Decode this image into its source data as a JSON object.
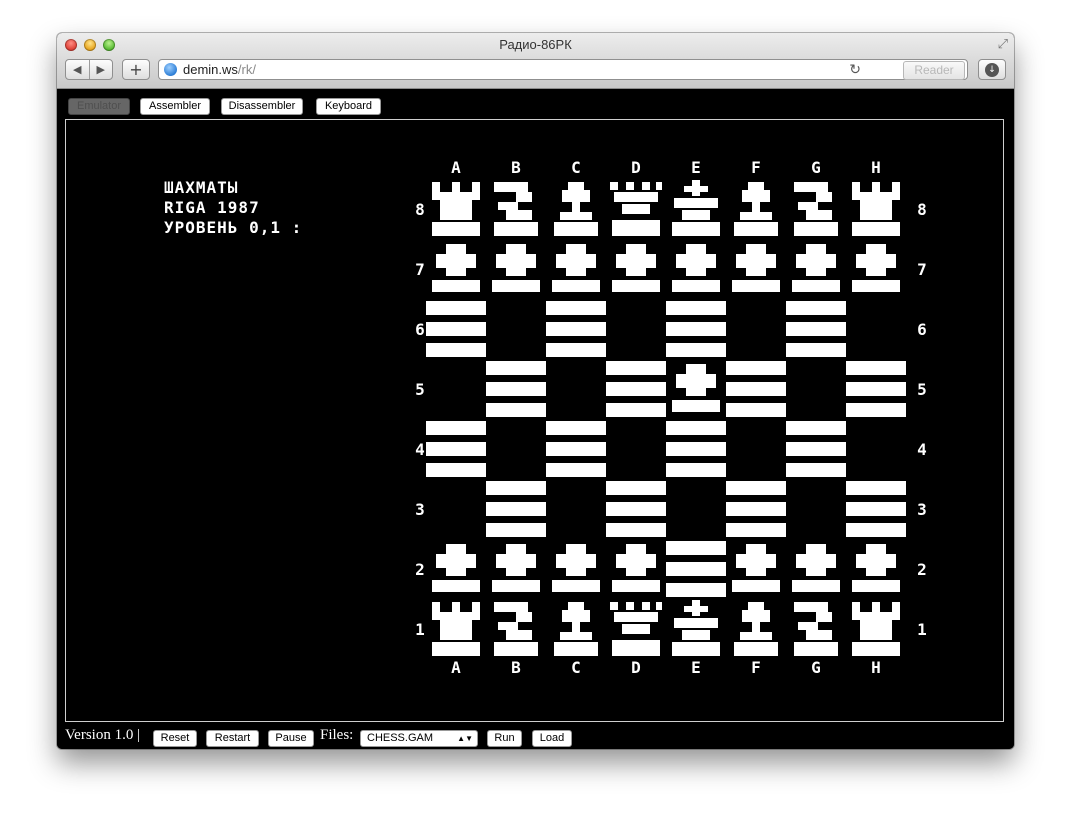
{
  "window": {
    "title": "Радио-86РК"
  },
  "url": {
    "host": "demin.ws",
    "path": "/rk/"
  },
  "reader_label": "Reader",
  "topbar": {
    "emulator": "Emulator",
    "assembler": "Assembler",
    "disassembler": "Disassembler",
    "keyboard": "Keyboard"
  },
  "screen": {
    "line1": "ШАХМАТЫ",
    "line2": "RIGA 1987",
    "line3": "УРОВЕНЬ 0,1 :",
    "files": [
      "A",
      "B",
      "C",
      "D",
      "E",
      "F",
      "G",
      "H"
    ],
    "ranks": [
      "8",
      "7",
      "6",
      "5",
      "4",
      "3",
      "2",
      "1"
    ]
  },
  "board": {
    "rank8": [
      "rook",
      "knight",
      "bishop",
      "queen",
      "king",
      "bishop",
      "knight",
      "rook"
    ],
    "rank7": [
      "pawn",
      "pawn",
      "pawn",
      "pawn",
      "pawn",
      "pawn",
      "pawn",
      "pawn"
    ],
    "rank5": [
      "",
      "",
      "",
      "",
      "pawn",
      "",
      "",
      ""
    ],
    "rank2": [
      "pawn",
      "pawn",
      "pawn",
      "pawn",
      "",
      "pawn",
      "pawn",
      "pawn"
    ],
    "rank1": [
      "rook",
      "knight",
      "bishop",
      "queen",
      "king",
      "bishop",
      "knight",
      "rook"
    ]
  },
  "bottom": {
    "version": "Version 1.0 |",
    "reset": "Reset",
    "restart": "Restart",
    "pause": "Pause",
    "files_label": "Files:",
    "file_selected": "CHESS.GAM",
    "run": "Run",
    "load": "Load"
  }
}
